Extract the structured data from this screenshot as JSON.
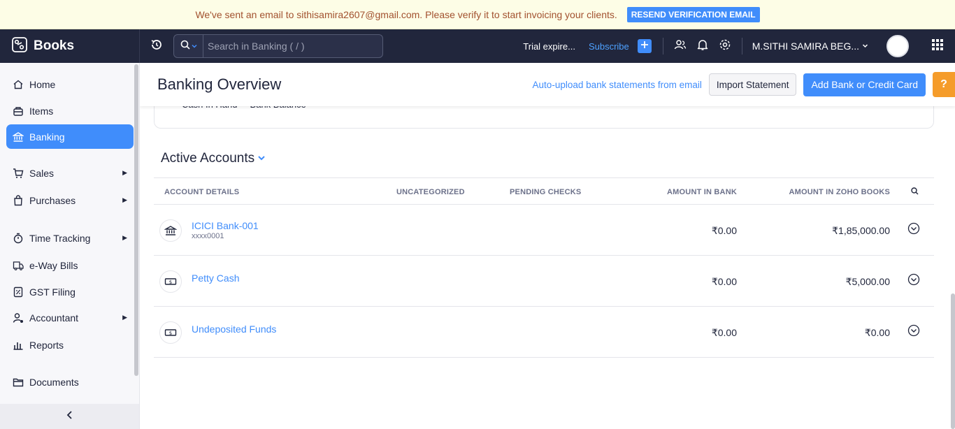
{
  "banner": {
    "message": "We've sent an email to sithisamira2607@gmail.com. Please verify it to start invoicing your clients.",
    "resend_label": "RESEND VERIFICATION EMAIL"
  },
  "topbar": {
    "brand": "Books",
    "search_placeholder": "Search in Banking ( / )",
    "trial_text": "Trial expire...",
    "subscribe_label": "Subscribe",
    "user_name": "M.SITHI SAMIRA BEG..."
  },
  "sidebar": {
    "items": [
      {
        "label": "Home",
        "icon": "home-icon"
      },
      {
        "label": "Items",
        "icon": "items-icon"
      },
      {
        "label": "Banking",
        "icon": "bank-icon"
      },
      {
        "label": "Sales",
        "icon": "cart-icon"
      },
      {
        "label": "Purchases",
        "icon": "bag-icon"
      },
      {
        "label": "Time Tracking",
        "icon": "timer-icon"
      },
      {
        "label": "e-Way Bills",
        "icon": "truck-icon"
      },
      {
        "label": "GST Filing",
        "icon": "gst-icon"
      },
      {
        "label": "Accountant",
        "icon": "accountant-icon"
      },
      {
        "label": "Reports",
        "icon": "reports-icon"
      },
      {
        "label": "Documents",
        "icon": "folder-icon"
      }
    ]
  },
  "page": {
    "title": "Banking Overview",
    "auto_upload_link": "Auto-upload bank statements from email",
    "import_label": "Import Statement",
    "add_label": "Add Bank or Credit Card",
    "help_label": "?",
    "legend_partial": "Cash In Hand     Bank Balance"
  },
  "accounts": {
    "section_title": "Active Accounts",
    "columns": [
      "ACCOUNT DETAILS",
      "UNCATEGORIZED",
      "PENDING CHECKS",
      "AMOUNT IN BANK",
      "AMOUNT IN ZOHO BOOKS"
    ],
    "rows": [
      {
        "name": "ICICI Bank-001",
        "sub": "xxxx0001",
        "bank": "₹0.00",
        "books": "₹1,85,000.00"
      },
      {
        "name": "Petty Cash",
        "sub": "",
        "bank": "₹0.00",
        "books": "₹5,000.00"
      },
      {
        "name": "Undeposited Funds",
        "sub": "",
        "bank": "₹0.00",
        "books": "₹0.00"
      }
    ]
  },
  "colors": {
    "primary": "#408dfb",
    "topbar_bg": "#21263c",
    "banner_bg": "#fdfde6",
    "banner_text": "#a2512f",
    "help_bg": "#f59c2a"
  }
}
